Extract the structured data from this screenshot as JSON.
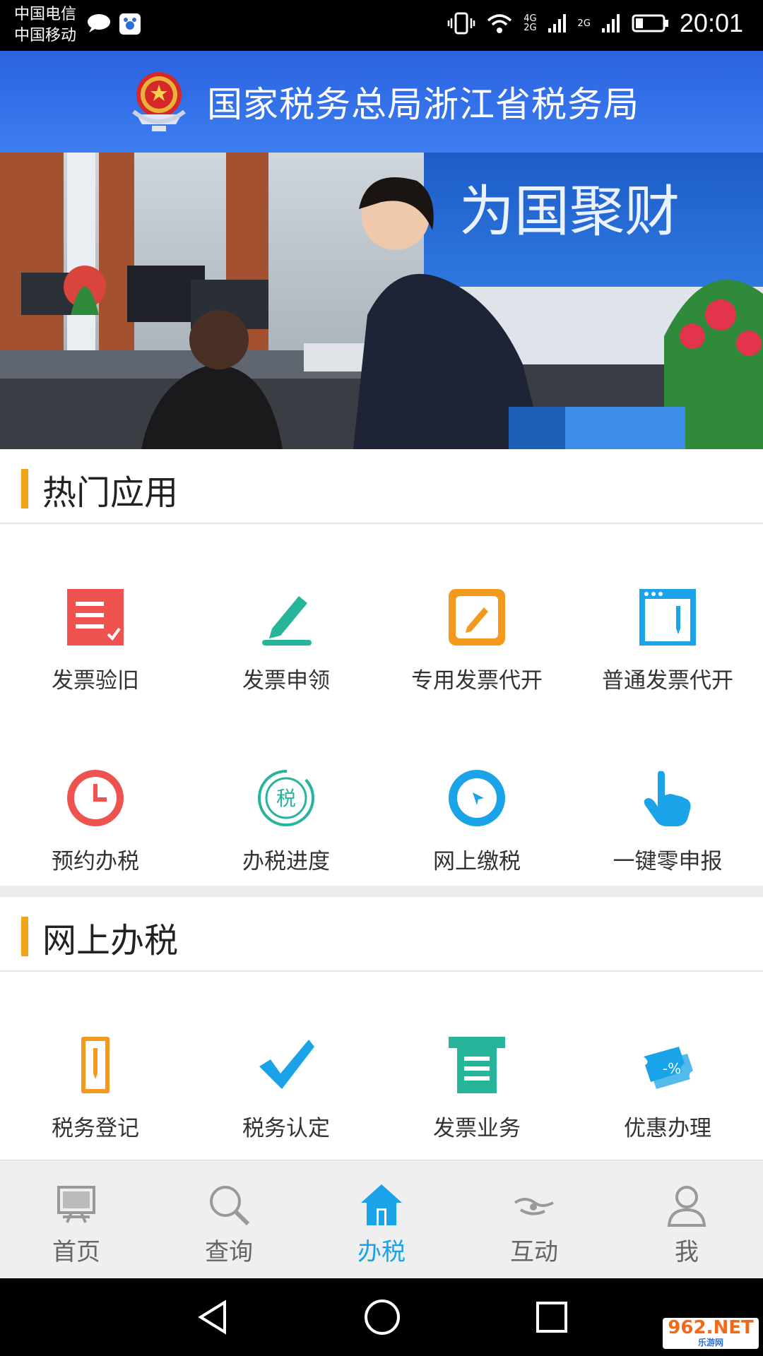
{
  "status_bar": {
    "carrier_1": "中国电信",
    "carrier_2": "中国移动",
    "network_1": "4G",
    "network_2": "2G",
    "network_3": "2G",
    "time": "20:01"
  },
  "header": {
    "title": "国家税务总局浙江省税务局"
  },
  "banner": {
    "sign_text": "为国聚财"
  },
  "hot_apps": {
    "title": "热门应用",
    "items": [
      {
        "label": "发票验旧",
        "icon": "invoice-check-icon",
        "color": "#ef5350"
      },
      {
        "label": "发票申领",
        "icon": "pen-icon",
        "color": "#26b59a"
      },
      {
        "label": "专用发票代开",
        "icon": "edit-box-icon",
        "color": "#f39a1e"
      },
      {
        "label": "普通发票代开",
        "icon": "browser-doc-icon",
        "color": "#1aa3e8"
      },
      {
        "label": "预约办税",
        "icon": "clock-icon",
        "color": "#ef5350"
      },
      {
        "label": "办税进度",
        "icon": "tax-progress-icon",
        "color": "#26b59a"
      },
      {
        "label": "网上缴税",
        "icon": "cursor-circle-icon",
        "color": "#1aa3e8"
      },
      {
        "label": "一键零申报",
        "icon": "hand-pointer-icon",
        "color": "#1aa3e8"
      }
    ]
  },
  "online_tax": {
    "title": "网上办税",
    "items": [
      {
        "label": "税务登记",
        "icon": "register-icon",
        "color": "#f39a1e"
      },
      {
        "label": "税务认定",
        "icon": "checkmark-icon",
        "color": "#1aa3e8"
      },
      {
        "label": "发票业务",
        "icon": "receipt-icon",
        "color": "#26b59a"
      },
      {
        "label": "优惠办理",
        "icon": "discount-ticket-icon",
        "color": "#1aa3e8"
      }
    ]
  },
  "tab_bar": {
    "items": [
      {
        "label": "首页"
      },
      {
        "label": "查询"
      },
      {
        "label": "办税"
      },
      {
        "label": "互动"
      },
      {
        "label": "我"
      }
    ],
    "active_color": "#1aa3e8"
  },
  "watermark": {
    "brand": "962.NET",
    "sub": "乐游网"
  }
}
